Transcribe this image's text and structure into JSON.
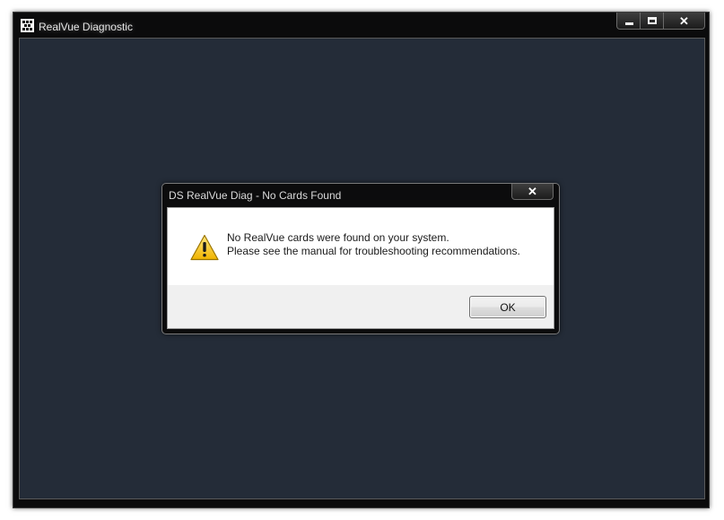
{
  "main_window": {
    "title": "RealVue Diagnostic",
    "caption_buttons": {
      "minimize": "minimize-icon",
      "maximize": "maximize-icon",
      "close": "✕"
    }
  },
  "dialog": {
    "title": "DS RealVue Diag - No Cards Found",
    "close_glyph": "✕",
    "icon": "warning-icon",
    "message_line1": "No RealVue cards were found on your system.",
    "message_line2": "Please see the manual for troubleshooting recommendations.",
    "ok_label": "OK"
  },
  "colors": {
    "client_background": "#242c38",
    "frame": "#0b0b0c",
    "warning_yellow": "#f5c400"
  }
}
